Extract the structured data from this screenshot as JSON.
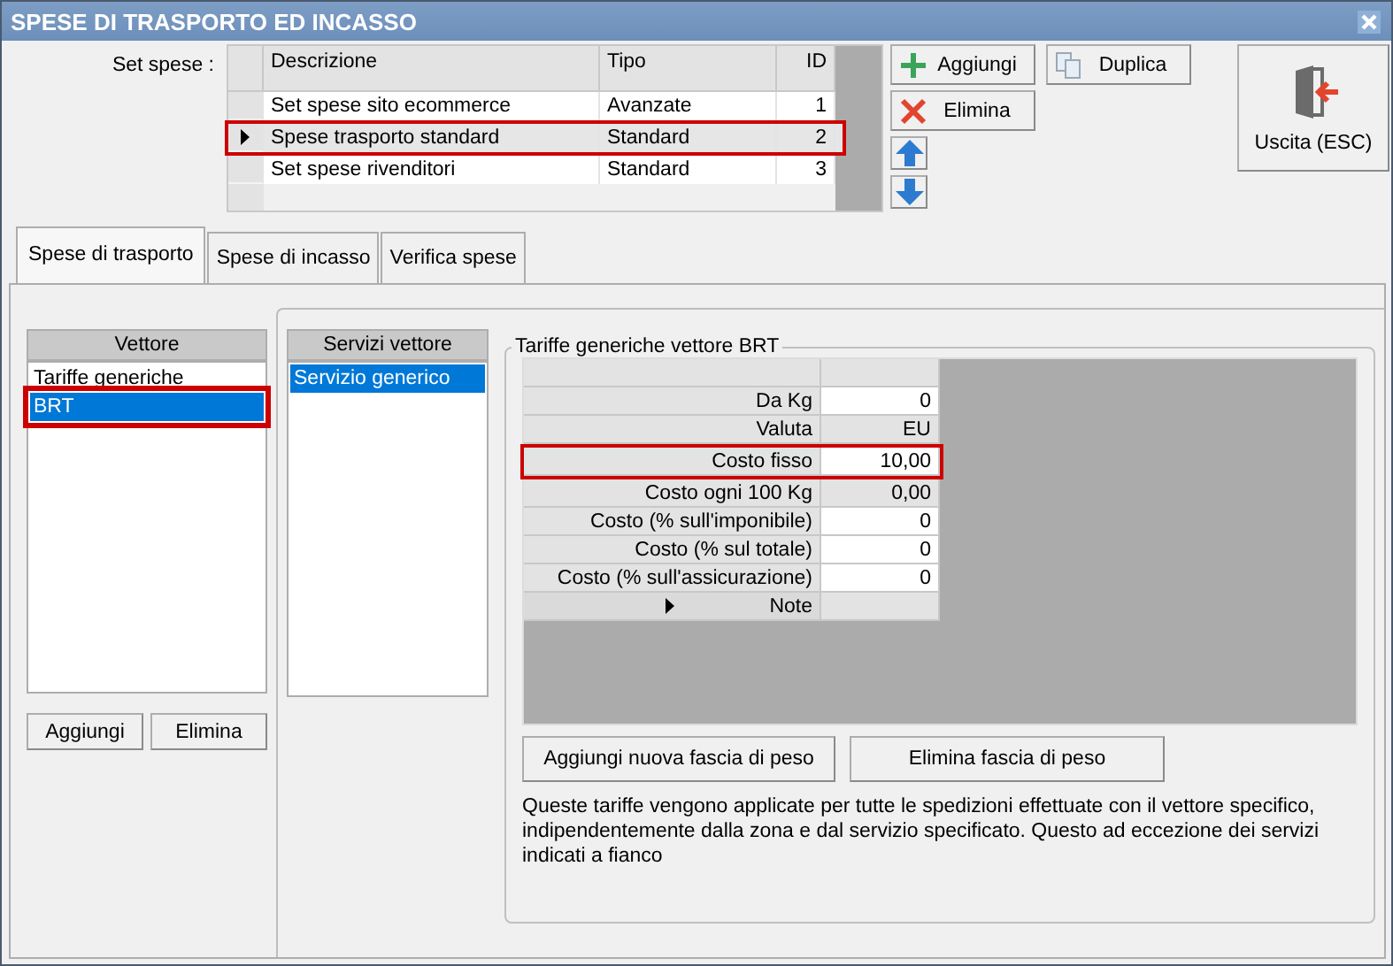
{
  "window": {
    "title": "SPESE DI TRASPORTO ED INCASSO"
  },
  "set_spese": {
    "label": "Set spese :",
    "columns": [
      "Descrizione",
      "Tipo",
      "ID"
    ],
    "rows": [
      {
        "descrizione": "Set spese sito ecommerce",
        "tipo": "Avanzate",
        "id": "1",
        "selected": false,
        "highlighted": false
      },
      {
        "descrizione": "Spese trasporto standard",
        "tipo": "Standard",
        "id": "2",
        "selected": true,
        "highlighted": true
      },
      {
        "descrizione": "Set spese rivenditori",
        "tipo": "Standard",
        "id": "3",
        "selected": false,
        "highlighted": false
      }
    ]
  },
  "toolbar": [
    {
      "kind": "add",
      "label": "Aggiungi"
    },
    {
      "kind": "duplicate",
      "label": "Duplica"
    },
    {
      "kind": "delete",
      "label": "Elimina"
    },
    {
      "kind": "up"
    },
    {
      "kind": "down"
    }
  ],
  "exit_button": {
    "label": "Uscita (ESC)"
  },
  "tabs": [
    {
      "label": "Spese di trasporto",
      "selected": true
    },
    {
      "label": "Spese di incasso",
      "selected": false
    },
    {
      "label": "Verifica spese",
      "selected": false
    }
  ],
  "vettore": {
    "header": "Vettore",
    "items": [
      {
        "label": "Tariffe generiche",
        "selected": false,
        "highlighted": false
      },
      {
        "label": "BRT",
        "selected": true,
        "highlighted": true
      }
    ],
    "buttons": [
      "Aggiungi",
      "Elimina"
    ]
  },
  "servizi": {
    "header": "Servizi vettore",
    "items": [
      {
        "label": "Servizio generico",
        "selected": true
      }
    ]
  },
  "tariffe": {
    "title": "Tariffe generiche vettore BRT",
    "rows": [
      {
        "label": "Da Kg",
        "value": "0",
        "editable": true,
        "current": false,
        "highlighted": false
      },
      {
        "label": "Valuta",
        "value": "EU",
        "editable": false,
        "current": false,
        "highlighted": false
      },
      {
        "label": "Costo fisso",
        "value": "10,00",
        "editable": true,
        "current": false,
        "highlighted": true
      },
      {
        "label": "Costo ogni 100 Kg",
        "value": "0,00",
        "editable": false,
        "current": false,
        "highlighted": false
      },
      {
        "label": "Costo (% sull'imponibile)",
        "value": "0",
        "editable": true,
        "current": false,
        "highlighted": false
      },
      {
        "label": "Costo (% sul totale)",
        "value": "0",
        "editable": true,
        "current": false,
        "highlighted": false
      },
      {
        "label": "Costo (% sull'assicurazione)",
        "value": "0",
        "editable": true,
        "current": false,
        "highlighted": false
      },
      {
        "label": "Note",
        "editable": false,
        "current": true,
        "highlighted": false
      }
    ],
    "buttons": [
      "Aggiungi nuova fascia di peso",
      "Elimina fascia di peso"
    ],
    "note": "Queste tariffe vengono applicate per tutte le spedizioni effettuate con il vettore specifico, indipendentemente dalla zona e dal servizio specificato. Questo ad eccezione dei servizi indicati a fianco"
  }
}
